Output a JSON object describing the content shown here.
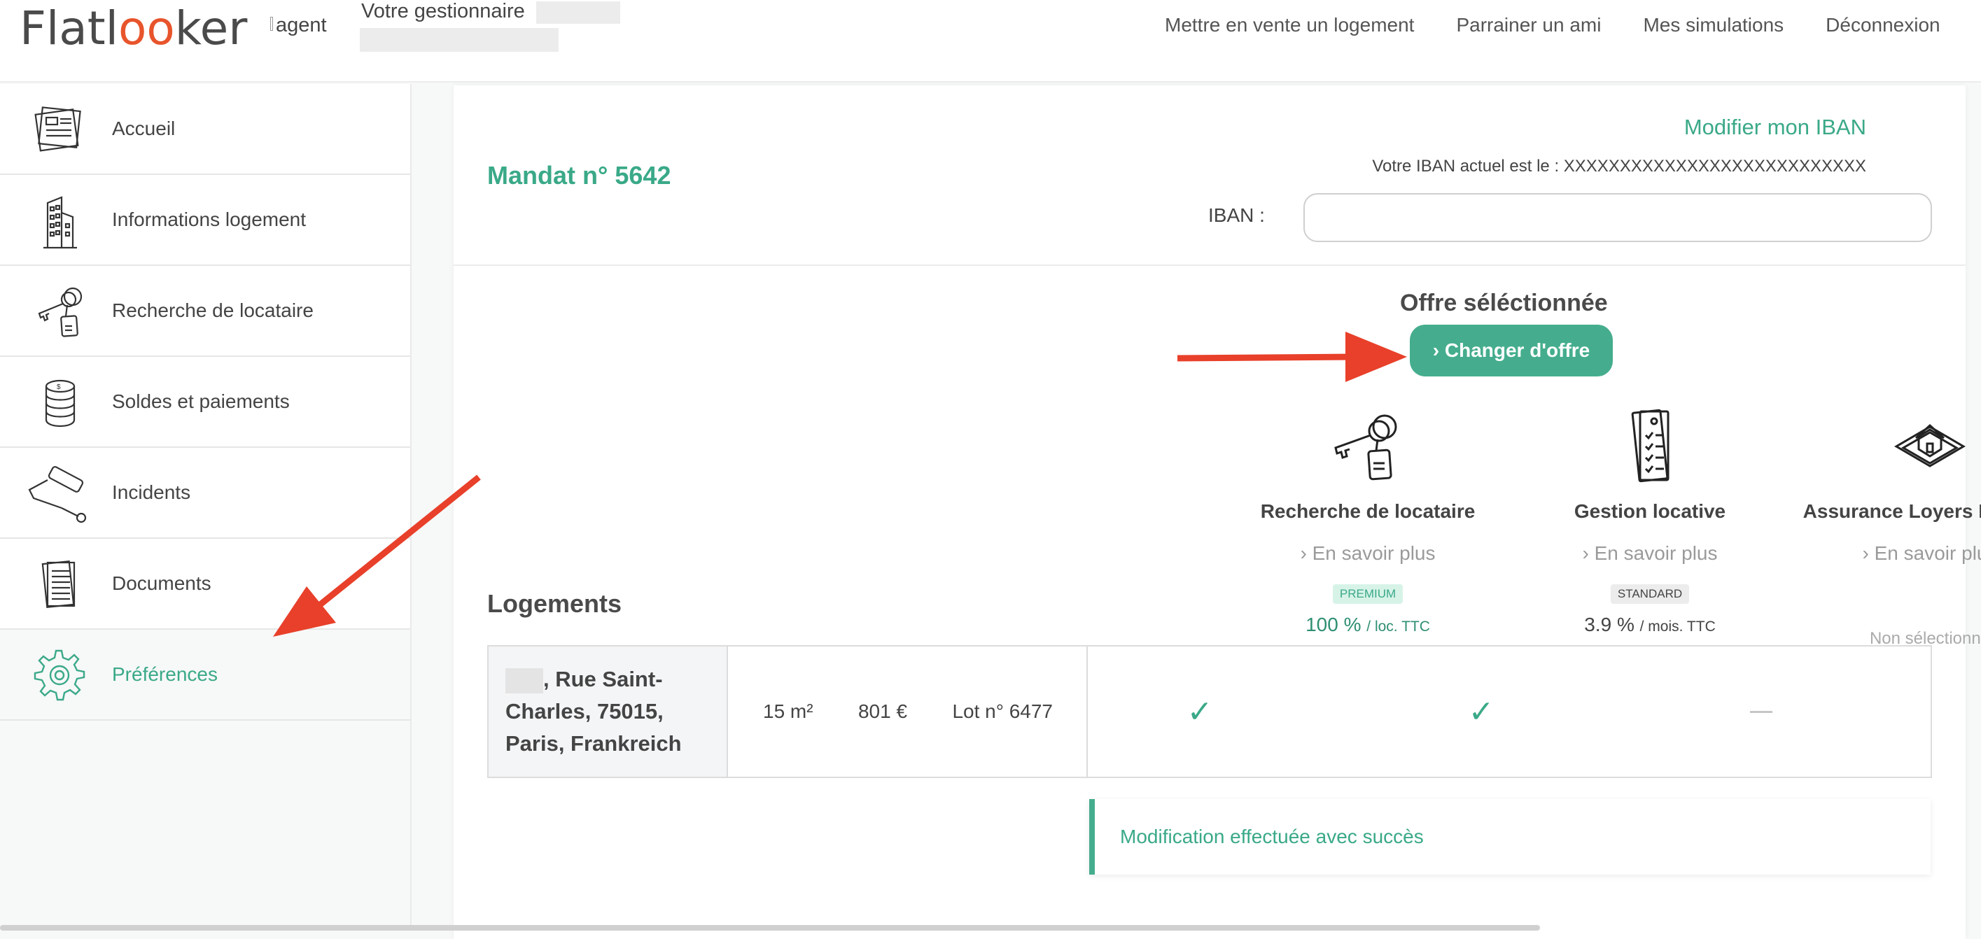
{
  "header": {
    "logo_text": "Flatlooker",
    "agent_img_alt": "agent",
    "manager_label": "Votre gestionnaire",
    "nav": [
      "Mettre en vente un logement",
      "Parrainer un ami",
      "Mes simulations",
      "Déconnexion"
    ]
  },
  "sidebar": {
    "items": [
      {
        "label": "Accueil",
        "icon": "dashboard-icon"
      },
      {
        "label": "Informations logement",
        "icon": "building-icon"
      },
      {
        "label": "Recherche de locataire",
        "icon": "keys-icon"
      },
      {
        "label": "Soldes et paiements",
        "icon": "coins-icon"
      },
      {
        "label": "Incidents",
        "icon": "paint-roller-icon"
      },
      {
        "label": "Documents",
        "icon": "document-icon"
      },
      {
        "label": "Préférences",
        "icon": "gear-icon",
        "active": true
      }
    ]
  },
  "mandate": {
    "title": "Mandat n° 5642",
    "iban_link": "Modifier mon IBAN",
    "iban_current": "Votre IBAN actuel est le : XXXXXXXXXXXXXXXXXXXXXXXXXXX",
    "iban_label": "IBAN :",
    "iban_value": ""
  },
  "offer": {
    "title": "Offre séléctionnée",
    "change_button": "› Changer d'offre",
    "services": [
      {
        "name": "Recherche de locataire",
        "more": "›  En savoir plus",
        "badge": "PREMIUM",
        "price": "100 %",
        "price_unit": "/ loc. TTC",
        "icon": "keys-icon"
      },
      {
        "name": "Gestion locative",
        "more": "›  En savoir plus",
        "badge": "STANDARD",
        "price": "3.9 %",
        "price_unit": "/ mois. TTC",
        "icon": "checklist-icon"
      },
      {
        "name": "Assurance Loyers Impayés",
        "more": "›  En savoir plus",
        "status": "Non sélectionné",
        "icon": "house-insurance-icon"
      }
    ]
  },
  "logements": {
    "title": "Logements",
    "rows": [
      {
        "address": ", Rue Saint-Charles, 75015, Paris, Frankreich",
        "surface": "15 m²",
        "rent": "801 €",
        "lot": "Lot n° 6477",
        "checks": [
          "✓",
          "✓",
          "—"
        ]
      }
    ]
  },
  "toast": {
    "message": "Modification effectuée avec succès"
  },
  "colors": {
    "accent": "#45ad8d",
    "accent_text": "#3aa988",
    "logo_o": "#e8542c",
    "annotation_arrow": "#e8402a"
  }
}
